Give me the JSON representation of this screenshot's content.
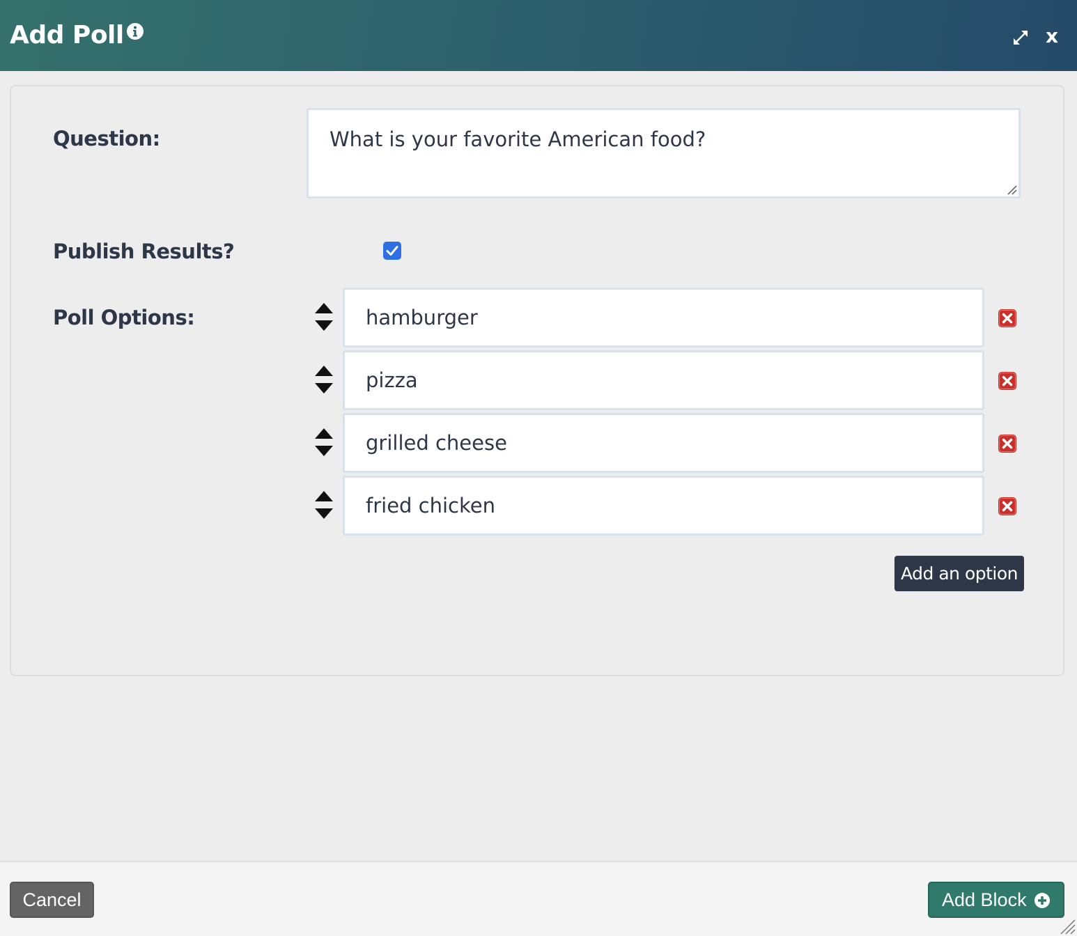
{
  "window": {
    "title": "Add Poll",
    "icons": [
      "info-icon",
      "expand-icon",
      "close-icon"
    ],
    "close_label": "x"
  },
  "form": {
    "question_label": "Question:",
    "question_value": "What is your favorite American food?",
    "publish_label": "Publish Results?",
    "publish_checked": true,
    "options_label": "Poll Options:",
    "options": [
      {
        "value": "hamburger"
      },
      {
        "value": "pizza"
      },
      {
        "value": "grilled cheese"
      },
      {
        "value": "fried chicken"
      }
    ],
    "add_option_label": "Add an option"
  },
  "footer": {
    "cancel_label": "Cancel",
    "add_block_label": "Add Block"
  },
  "colors": {
    "header_gradient_start": "#35716c",
    "header_gradient_end": "#254a6a",
    "checkbox": "#2f6fe4",
    "delete": "#c9302c",
    "add_option_bg": "#2d3748",
    "add_block_bg": "#2f7a6a",
    "cancel_bg": "#646464"
  }
}
